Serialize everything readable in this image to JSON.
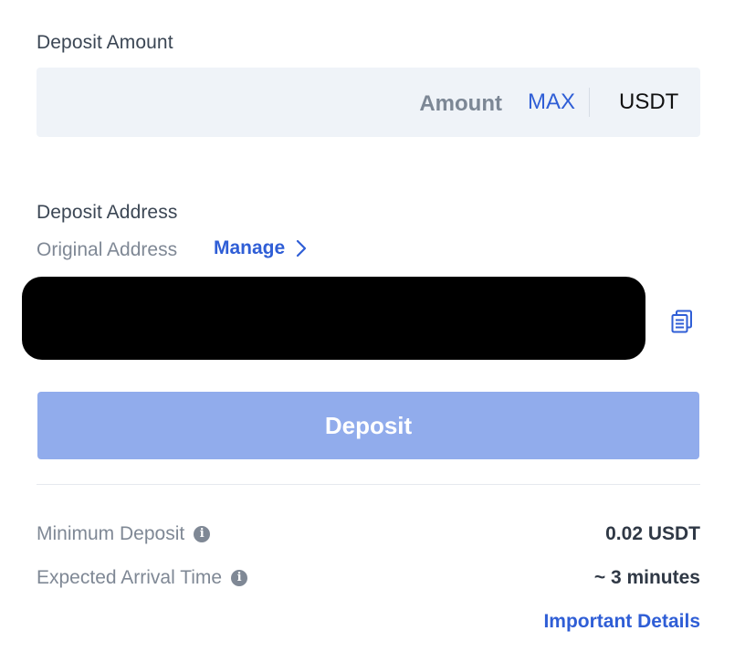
{
  "deposit_amount": {
    "label": "Deposit Amount",
    "input_placeholder": "Amount",
    "input_value": "",
    "max_label": "MAX",
    "currency": "USDT"
  },
  "deposit_address": {
    "label": "Deposit Address",
    "address_type": "Original Address",
    "manage_label": "Manage",
    "address_value": "",
    "copy_icon": "copy-icon"
  },
  "actions": {
    "deposit_label": "Deposit"
  },
  "details": {
    "minimum_deposit_label": "Minimum Deposit",
    "minimum_deposit_value": "0.02 USDT",
    "arrival_time_label": "Expected Arrival Time",
    "arrival_time_value": "~ 3 minutes",
    "info_icon": "info-icon",
    "important_details_label": "Important Details"
  },
  "colors": {
    "accent": "#2f5ed6",
    "button_disabled": "#91acec",
    "input_bg": "#eff3f8",
    "muted_text": "#7f8895"
  }
}
